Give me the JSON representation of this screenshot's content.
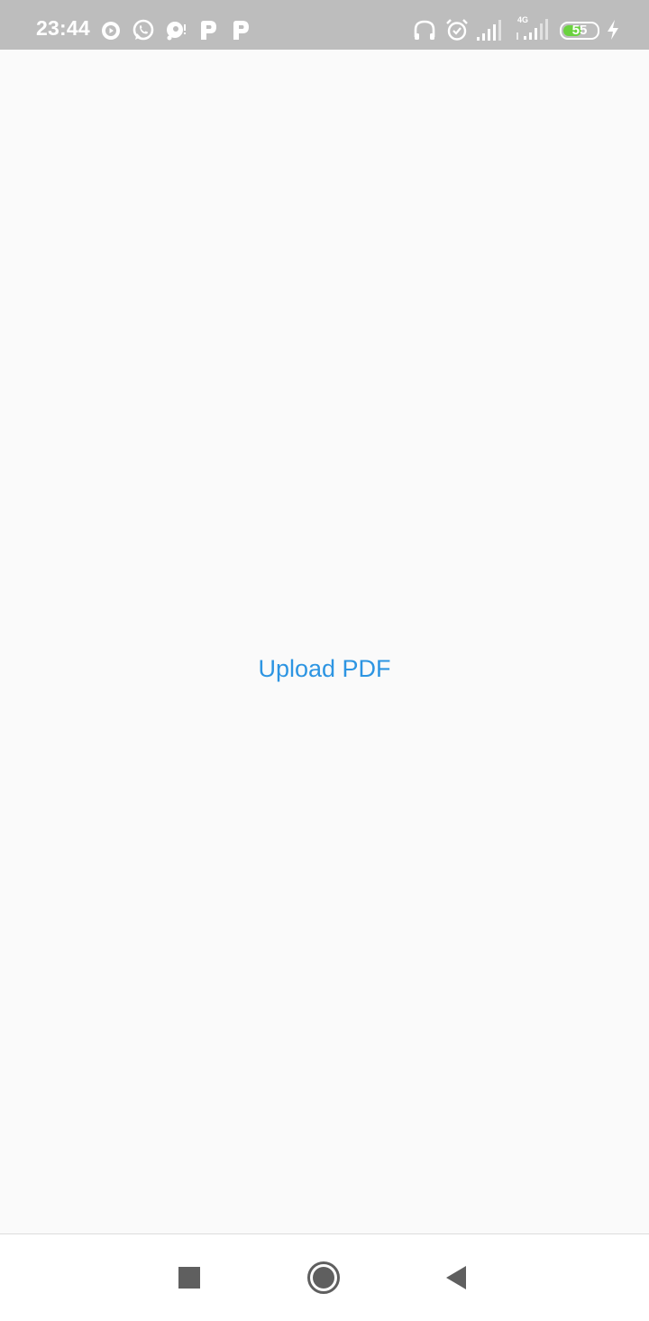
{
  "status_bar": {
    "time": "23:44",
    "network_type": "4G",
    "battery_level": "55",
    "battery_fraction": 0.55,
    "colors": {
      "background": "#bdbdbd",
      "battery_fill": "#6bd23f"
    },
    "left_icons": [
      "play-circle-icon",
      "whatsapp-icon",
      "notification-dot-icon",
      "parking-p-icon",
      "parking-p-icon"
    ],
    "right_icons": [
      "headset-icon",
      "alarm-icon",
      "signal-bars-icon",
      "signal-4g-icon",
      "battery-icon",
      "charging-icon"
    ]
  },
  "main": {
    "upload_label": "Upload PDF",
    "accent_color": "#2d95e2"
  },
  "nav_bar": {
    "icons": [
      "recents-square-icon",
      "home-circle-icon",
      "back-triangle-icon"
    ]
  }
}
